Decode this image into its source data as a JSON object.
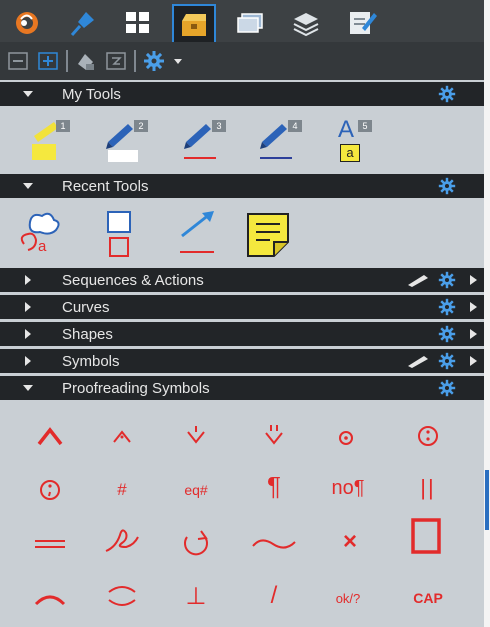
{
  "tabs": [
    {
      "icon": "acrobat-logo-icon",
      "active": false
    },
    {
      "icon": "pushpin-icon",
      "active": false
    },
    {
      "icon": "grid-icon",
      "active": false
    },
    {
      "icon": "tool-chest-icon",
      "active": true
    },
    {
      "icon": "layers-panel-icon",
      "active": false
    },
    {
      "icon": "stack-icon",
      "active": false
    },
    {
      "icon": "notepad-pencil-icon",
      "active": false
    }
  ],
  "sections": {
    "my_tools": {
      "title": "My Tools",
      "expanded": true
    },
    "recent_tools": {
      "title": "Recent Tools",
      "expanded": true
    },
    "sequences": {
      "title": "Sequences & Actions",
      "expanded": false
    },
    "curves": {
      "title": "Curves",
      "expanded": false
    },
    "shapes": {
      "title": "Shapes",
      "expanded": false
    },
    "symbols": {
      "title": "Symbols",
      "expanded": false
    },
    "proofreading": {
      "title": "Proofreading Symbols",
      "expanded": true
    }
  },
  "my_tools": [
    {
      "badge": "1",
      "icon": "yellow-highlighter-icon"
    },
    {
      "badge": "2",
      "icon": "white-fill-pen-icon"
    },
    {
      "badge": "3",
      "icon": "red-line-pen-icon"
    },
    {
      "badge": "4",
      "icon": "blue-line-pen-icon"
    },
    {
      "badge": "5",
      "icon": "text-box-tool-icon",
      "glyph_a": "A",
      "glyph_small": "a"
    }
  ],
  "recent_tools": [
    {
      "icon": "cloud-callout-icon",
      "glyph": "a"
    },
    {
      "icon": "rectangle-tool-icon"
    },
    {
      "icon": "arrow-line-tool-icon"
    },
    {
      "icon": "sticky-note-icon"
    }
  ],
  "proofreading_symbols": [
    {
      "icon": "caret-insert-icon",
      "text": ""
    },
    {
      "icon": "insert-comma-icon",
      "text": ""
    },
    {
      "icon": "insert-apostrophe-icon",
      "text": ""
    },
    {
      "icon": "insert-quotes-icon",
      "text": ""
    },
    {
      "icon": "insert-period-icon",
      "text": ""
    },
    {
      "icon": "insert-colon-icon",
      "text": ""
    },
    {
      "icon": "insert-semicolon-icon",
      "text": ""
    },
    {
      "icon": "insert-space-icon",
      "text": "#"
    },
    {
      "icon": "equal-space-icon",
      "text": "eq#"
    },
    {
      "icon": "paragraph-icon",
      "text": "¶"
    },
    {
      "icon": "no-paragraph-icon",
      "text": "no¶"
    },
    {
      "icon": "align-vertical-icon",
      "text": "||"
    },
    {
      "icon": "align-horizontal-icon",
      "text": ""
    },
    {
      "icon": "delete-mark-icon",
      "text": ""
    },
    {
      "icon": "transpose-icon",
      "text": ""
    },
    {
      "icon": "transpose-wavy-icon",
      "text": ""
    },
    {
      "icon": "remove-mark-icon",
      "text": "×"
    },
    {
      "icon": "box-mark-icon",
      "text": ""
    },
    {
      "icon": "close-up-icon",
      "text": ""
    },
    {
      "icon": "close-space-icon",
      "text": ""
    },
    {
      "icon": "em-dash-icon",
      "text": "⊥"
    },
    {
      "icon": "lowercase-slash-icon",
      "text": "/"
    },
    {
      "icon": "ok-query-icon",
      "text": "ok/?"
    },
    {
      "icon": "capitalize-icon",
      "text": "CAP"
    }
  ],
  "colors": {
    "panel_bg": "#c9cfd4",
    "header_bg": "#222528",
    "tabbar_bg": "#3d4144",
    "accent_blue": "#2f87d8",
    "gear_blue": "#4a9ee8",
    "proof_red": "#e22b2b"
  }
}
